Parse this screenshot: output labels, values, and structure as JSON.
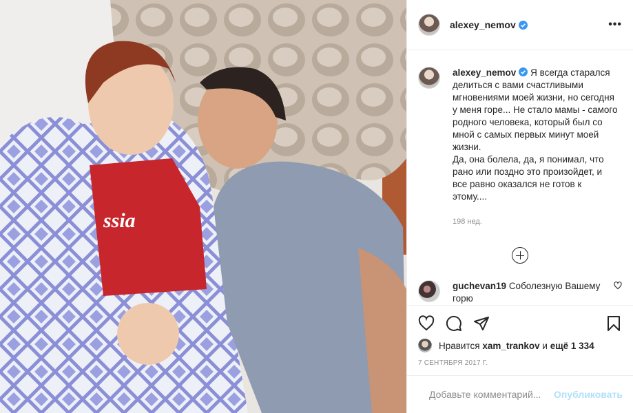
{
  "post": {
    "username": "alexey_nemov",
    "caption": "Я всегда старался делиться с вами счастливыми мгновениями моей жизни, но сегодня у меня горе... Не стало мамы - самого родного человека, который был со мной с самых первых минут моей жизни.\nДа, она болела, да, я понимал, что рано или поздно это произойдет, и все равно оказался не готов к этому....",
    "caption_time": "198 нед.",
    "likes": {
      "prefix": "Нравится",
      "user": "xam_trankov",
      "and": "и",
      "count_text": "ещё 1 334"
    },
    "date": "7 СЕНТЯБРЯ 2017 Г.",
    "colors": {
      "verified": "#3897f0",
      "accent": "#0095f6",
      "disabled_button": "#b2dffc"
    }
  },
  "comments": [
    {
      "username": "guchevan19",
      "text": "Соболезную Вашему горю"
    }
  ],
  "add_comment": {
    "placeholder": "Добавьте комментарий...",
    "post_label": "Опубликовать"
  },
  "icons": {
    "more": "more-horizontal-icon",
    "like": "heart-icon",
    "comment": "comment-bubble-icon",
    "share": "paper-plane-icon",
    "save": "bookmark-icon",
    "emoji": "smiley-icon",
    "load_more": "plus-circle-icon",
    "verified": "verified-badge-icon"
  }
}
